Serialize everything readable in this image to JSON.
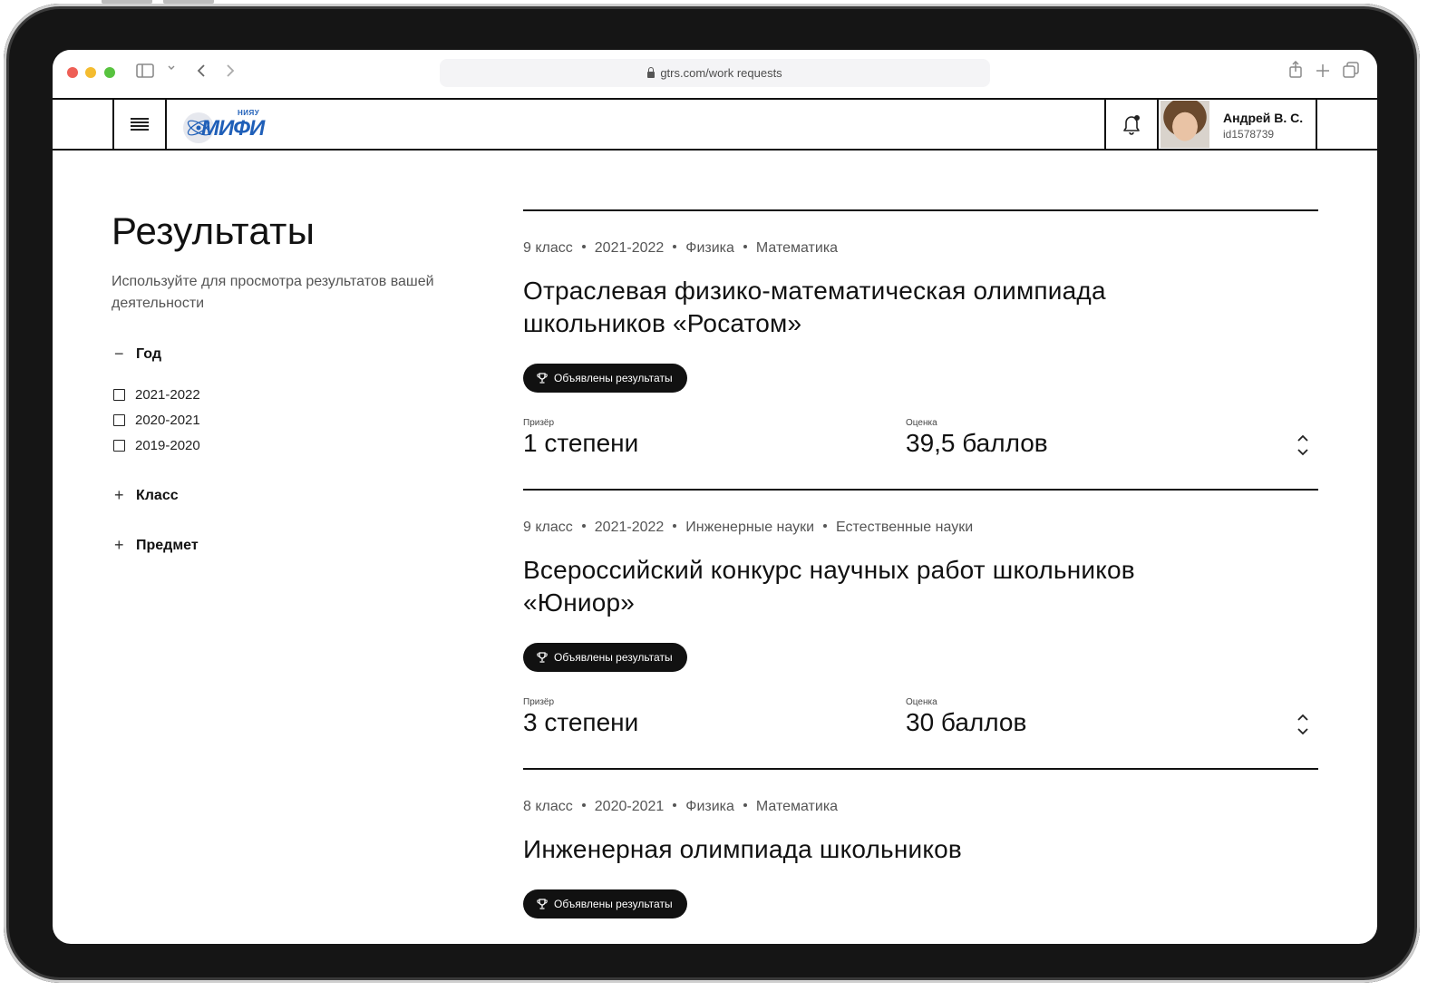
{
  "browser": {
    "url": "gtrs.com/work requests"
  },
  "header": {
    "logo_small": "НИЯУ",
    "logo_main": "МИФИ",
    "user_name": "Андрей В. С.",
    "user_id": "id1578739"
  },
  "sidebar": {
    "title": "Результаты",
    "subtitle": "Используйте для просмотра результатов вашей деятельности",
    "filters": {
      "year": {
        "sign": "−",
        "label": "Год",
        "options": [
          "2021-2022",
          "2020-2021",
          "2019-2020"
        ]
      },
      "class": {
        "sign": "+",
        "label": "Класс"
      },
      "subject": {
        "sign": "+",
        "label": "Предмет"
      }
    }
  },
  "results": [
    {
      "tags": [
        "9 класс",
        "2021-2022",
        "Физика",
        "Математика"
      ],
      "title": "Отраслевая физико-математическая олимпиада школьников «Росатом»",
      "badge": "Объявлены результаты",
      "prize_label": "Призёр",
      "prize_value": "1 степени",
      "score_label": "Оценка",
      "score_value": "39,5 баллов"
    },
    {
      "tags": [
        "9 класс",
        "2021-2022",
        "Инженерные науки",
        "Естественные науки"
      ],
      "title": "Всероссийский конкурс научных работ школьников «Юниор»",
      "badge": "Объявлены результаты",
      "prize_label": "Призёр",
      "prize_value": "3 степени",
      "score_label": "Оценка",
      "score_value": "30 баллов"
    },
    {
      "tags": [
        "8 класс",
        "2020-2021",
        "Физика",
        "Математика"
      ],
      "title": "Инженерная олимпиада школьников",
      "badge": "Объявлены результаты"
    }
  ]
}
